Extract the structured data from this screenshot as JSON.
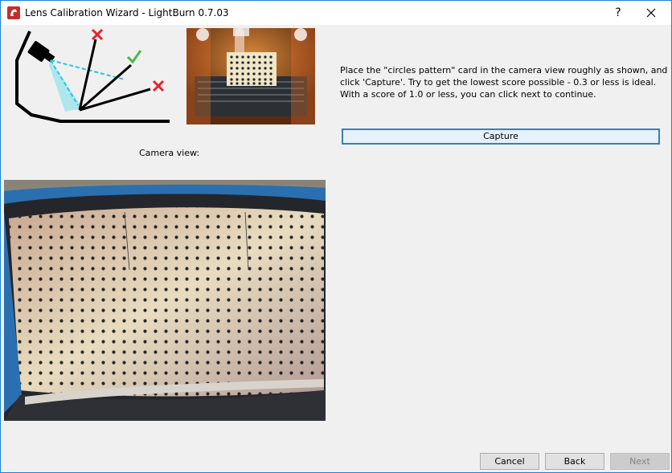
{
  "window": {
    "title": "Lens Calibration Wizard - LightBurn 0.7.03",
    "help_label": "?",
    "close_label": "✕"
  },
  "instructions": "Place the \"circles pattern\" card in the camera view roughly as shown, and click 'Capture'. Try to get the lowest score possible - 0.3 or less is ideal.  With a score of 1.0 or less, you can click next to continue.",
  "capture_label": "Capture",
  "camera_view_label": "Camera view:",
  "buttons": {
    "cancel": "Cancel",
    "back": "Back",
    "next": "Next"
  },
  "colors": {
    "accent": "#1883d7",
    "capture_border": "#3c7fb1",
    "brand_red": "#c0302b",
    "check_green": "#4cb847",
    "cross_red": "#e8222a",
    "beam_cyan": "#22c8e0"
  },
  "icons": {
    "app": "lightburn-logo-icon",
    "close": "close-icon"
  }
}
